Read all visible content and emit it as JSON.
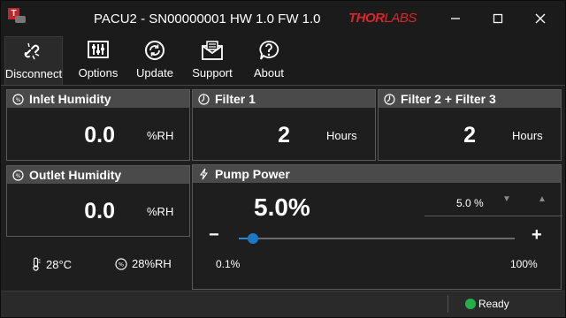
{
  "window": {
    "title": "PACU2 - SN00000001 HW 1.0 FW 1.0",
    "brand_a": "THOR",
    "brand_b": "LABS",
    "controls": [
      "minimize",
      "maximize",
      "close"
    ]
  },
  "toolbar": {
    "items": [
      {
        "label": "Disconnect",
        "icon": "unlink-icon"
      },
      {
        "label": "Options",
        "icon": "options-icon"
      },
      {
        "label": "Update",
        "icon": "refresh-icon"
      },
      {
        "label": "Support",
        "icon": "envelope-icon"
      },
      {
        "label": "About",
        "icon": "question-icon"
      }
    ]
  },
  "inlet": {
    "title": "Inlet Humidity",
    "value": "0.0",
    "unit": "%RH"
  },
  "outlet": {
    "title": "Outlet Humidity",
    "value": "0.0",
    "unit": "%RH"
  },
  "filter1": {
    "title": "Filter 1",
    "value": "2",
    "unit": "Hours"
  },
  "filter23": {
    "title": "Filter 2 + Filter 3",
    "value": "2",
    "unit": "Hours"
  },
  "pump": {
    "title": "Pump Power",
    "value_display": "5.0%",
    "spin_value": "5.0 %",
    "slider_min_label": "0.1%",
    "slider_max_label": "100%",
    "minus": "−",
    "plus": "+",
    "slider_fraction": 0.05
  },
  "ambient": {
    "temperature": "28°C",
    "humidity": "28%RH"
  },
  "status": {
    "text": "Ready",
    "color": "#22b14c"
  },
  "colors": {
    "accent": "#1a79c2",
    "brand": "#d8262c",
    "panel_header": "#4a4a4a"
  }
}
